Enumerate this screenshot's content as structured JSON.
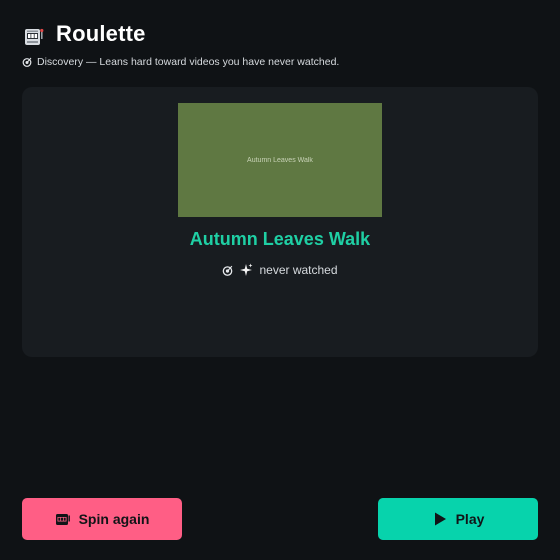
{
  "header": {
    "icon": "slot-machine-icon",
    "title": "Roulette"
  },
  "mode": {
    "icon": "dart-target-icon",
    "text": "Discovery — Leans hard toward videos you have never watched."
  },
  "video": {
    "thumbnail_text": "Autumn Leaves Walk",
    "thumbnail_color": "#5f7842",
    "title": "Autumn Leaves Walk",
    "title_color": "#1fcfa4",
    "status_icons": [
      "dart-target-icon",
      "sparkles-icon"
    ],
    "status_text": "never watched"
  },
  "actions": {
    "spin_label": "Spin again",
    "spin_icon": "slot-machine-icon",
    "spin_color": "#ff5e85",
    "play_label": "Play",
    "play_icon": "play-icon",
    "play_color": "#07d3ac"
  }
}
